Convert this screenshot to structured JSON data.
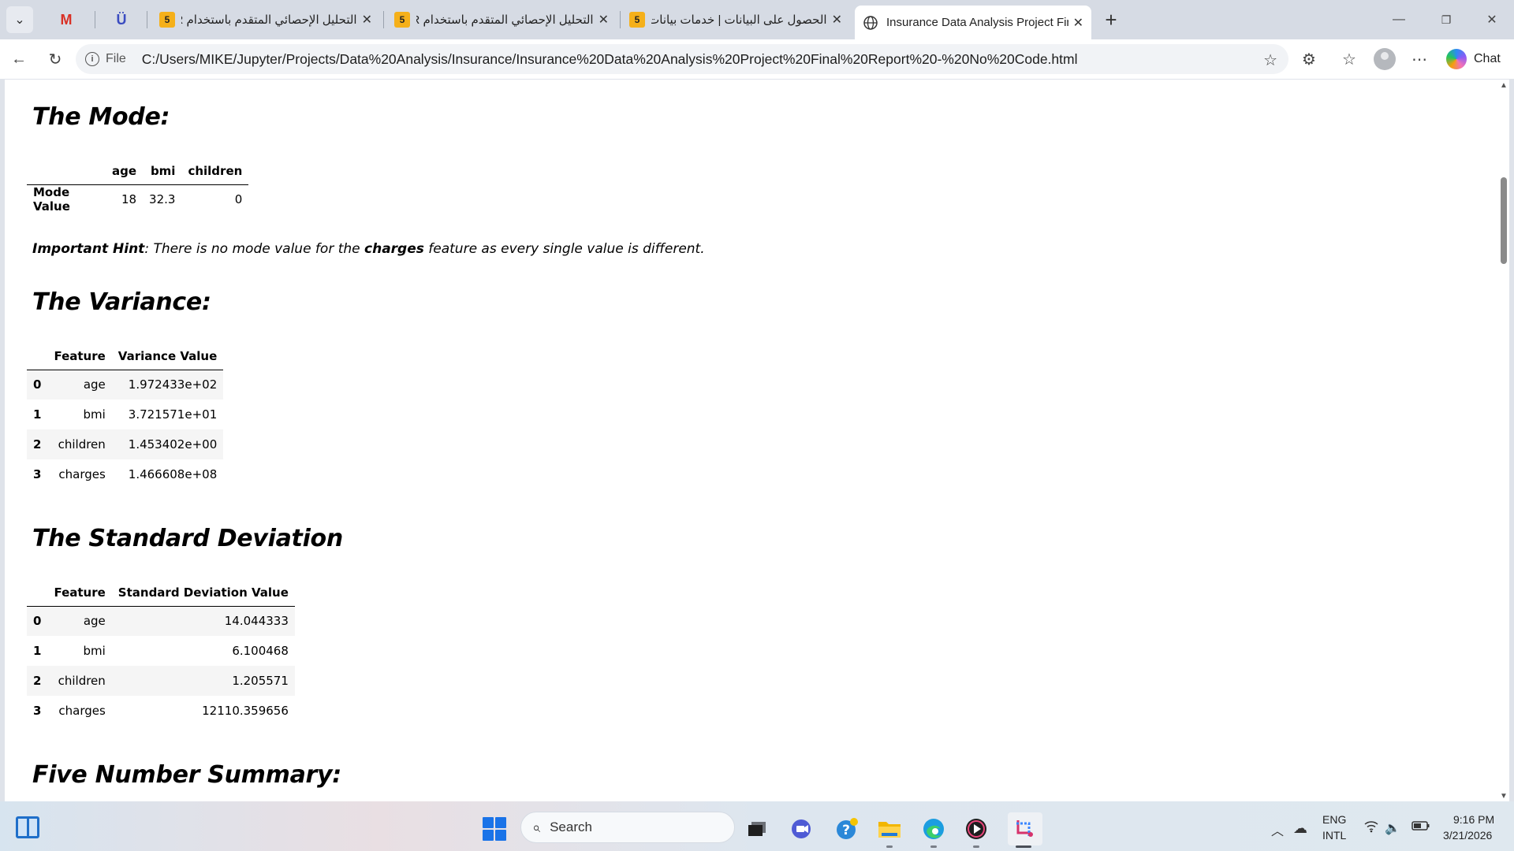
{
  "browser": {
    "tabs": [
      {
        "title": "التحليل الإحصائي المتقدم باستخدام R",
        "badge": "5"
      },
      {
        "title": "التحليل الإحصائي المتقدم باستخدام R",
        "badge": "5"
      },
      {
        "title": "الحصول على البيانات | خدمات بيانات",
        "badge": "5"
      },
      {
        "title": "Insurance Data Analysis Project Final Report - No Code"
      }
    ],
    "new_tab": "+",
    "scheme_label": "File",
    "url": "C:/Users/MIKE/Jupyter/Projects/Data%20Analysis/Insurance/Insurance%20Data%20Analysis%20Project%20Final%20Report%20-%20No%20Code.html",
    "chat_label": "Chat",
    "icons": [
      "tab-actions-icon",
      "gmail-icon",
      "ublock-icon",
      "back-icon",
      "reload-icon",
      "info-icon",
      "star-icon",
      "extensions-icon",
      "favorites-icon",
      "profile-icon",
      "more-icon",
      "copilot-icon"
    ]
  },
  "page": {
    "mode": {
      "heading": "The Mode:",
      "columns": [
        "",
        "age",
        "bmi",
        "children"
      ],
      "rows": [
        {
          "label": "Mode Value",
          "values": [
            "18",
            "32.3",
            "0"
          ]
        }
      ],
      "hint_label": "Important Hint",
      "hint_pre": ": There is no mode value for the ",
      "hint_bold": "charges",
      "hint_post": " feature as every single value is different."
    },
    "variance": {
      "heading": "The Variance:",
      "columns": [
        "",
        "Feature",
        "Variance Value"
      ],
      "rows": [
        {
          "idx": "0",
          "feature": "age",
          "value": "1.972433e+02"
        },
        {
          "idx": "1",
          "feature": "bmi",
          "value": "3.721571e+01"
        },
        {
          "idx": "2",
          "feature": "children",
          "value": "1.453402e+00"
        },
        {
          "idx": "3",
          "feature": "charges",
          "value": "1.466608e+08"
        }
      ]
    },
    "stddev": {
      "heading": "The Standard Deviation",
      "columns": [
        "",
        "Feature",
        "Standard Deviation Value"
      ],
      "rows": [
        {
          "idx": "0",
          "feature": "age",
          "value": "14.044333"
        },
        {
          "idx": "1",
          "feature": "bmi",
          "value": "6.100468"
        },
        {
          "idx": "2",
          "feature": "children",
          "value": "1.205571"
        },
        {
          "idx": "3",
          "feature": "charges",
          "value": "12110.359656"
        }
      ]
    },
    "five_number": {
      "heading": "Five Number Summary:"
    }
  },
  "taskbar": {
    "search_placeholder": "Search",
    "lang_line1": "ENG",
    "lang_line2": "INTL",
    "time": "9:16 PM",
    "date": "3/21/2026",
    "apps": [
      "widgets-icon",
      "start-icon",
      "search-icon",
      "task-view-icon",
      "meet-icon",
      "help-icon",
      "file-explorer-icon",
      "edge-icon",
      "media-player-icon",
      "snipping-tool-icon"
    ]
  }
}
